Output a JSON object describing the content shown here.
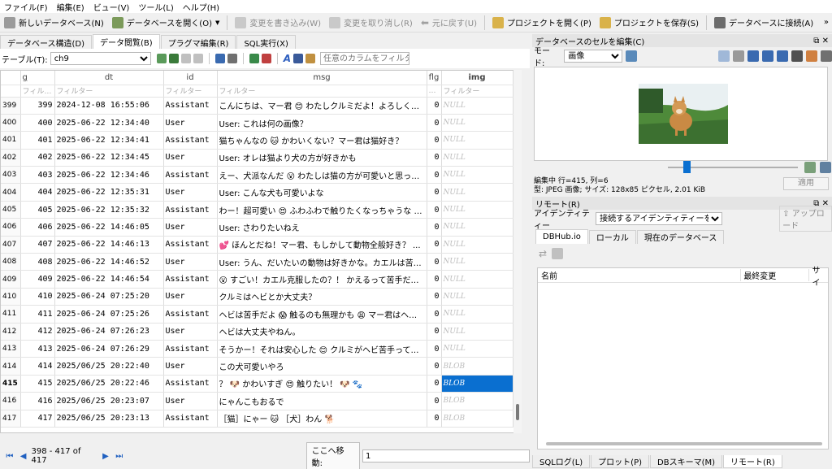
{
  "menu": [
    "ファイル(F)",
    "編集(E)",
    "ビュー(V)",
    "ツール(L)",
    "ヘルプ(H)"
  ],
  "toolbar": {
    "new_db": "新しいデータベース(N)",
    "open_db": "データベースを開く(O)",
    "write_changes": "変更を書き込み(W)",
    "revert_changes": "変更を取り消し(R)",
    "undo": "元に戻す(U)",
    "open_project": "プロジェクトを開く(P)",
    "save_project": "プロジェクトを保存(S)",
    "connect_db": "データベースに接続(A)"
  },
  "tabs": [
    {
      "label": "データベース構造(D)",
      "active": false
    },
    {
      "label": "データ閲覧(B)",
      "active": true
    },
    {
      "label": "プラグマ編集(R)",
      "active": false
    },
    {
      "label": "SQL実行(X)",
      "active": false
    }
  ],
  "table_toolbar": {
    "table_label": "テーブル(T):",
    "table_value": "ch9",
    "filter_any_placeholder": "任意のカラムをフィルター"
  },
  "grid": {
    "headers": [
      "g",
      "dt",
      "id",
      "msg",
      "flg",
      "img"
    ],
    "filter_placeholder": "フィルター",
    "rows": [
      {
        "rn": "399",
        "g": "399",
        "dt": "2024-12-08 16:55:06",
        "id": "Assistant",
        "msg": "こんにちは、マー君 😊 わたしクルミだよ！よろしくね 💕",
        "flg": "0",
        "img": "NULL"
      },
      {
        "rn": "400",
        "g": "400",
        "dt": "2025-06-22 12:34:40",
        "id": "User",
        "msg": "User: これは何の画像？",
        "flg": "0",
        "img": "NULL"
      },
      {
        "rn": "401",
        "g": "401",
        "dt": "2025-06-22 12:34:41",
        "id": "Assistant",
        "msg": "猫ちゃんなの 🐱 かわいくない？マー君は猫好き？",
        "flg": "0",
        "img": "NULL"
      },
      {
        "rn": "402",
        "g": "402",
        "dt": "2025-06-22 12:34:45",
        "id": "User",
        "msg": "User: オレは猫より犬の方が好きかも",
        "flg": "0",
        "img": "NULL"
      },
      {
        "rn": "403",
        "g": "403",
        "dt": "2025-06-22 12:34:46",
        "id": "Assistant",
        "msg": "えー、犬派なんだ 😮 わたしは猫の方が可愛いと思っちゃ...",
        "flg": "0",
        "img": "NULL"
      },
      {
        "rn": "404",
        "g": "404",
        "dt": "2025-06-22 12:35:31",
        "id": "User",
        "msg": "User: こんな犬も可愛いよな",
        "flg": "0",
        "img": "NULL"
      },
      {
        "rn": "405",
        "g": "405",
        "dt": "2025-06-22 12:35:32",
        "id": "Assistant",
        "msg": "わー！超可愛い 😍 ふわふわで触りたくなっちゃうな 🐾 マ...",
        "flg": "0",
        "img": "NULL"
      },
      {
        "rn": "406",
        "g": "406",
        "dt": "2025-06-22 14:46:05",
        "id": "User",
        "msg": "User: さわりたいねえ",
        "flg": "0",
        "img": "NULL"
      },
      {
        "rn": "407",
        "g": "407",
        "dt": "2025-06-22 14:46:13",
        "id": "Assistant",
        "msg": "💕 ほんとだね！マー君、もしかして動物全般好き？ ...",
        "flg": "0",
        "img": "NULL"
      },
      {
        "rn": "408",
        "g": "408",
        "dt": "2025-06-22 14:46:52",
        "id": "User",
        "msg": "User: うん、だいたいの動物は好きかな。カエルは苦手...",
        "flg": "0",
        "img": "NULL"
      },
      {
        "rn": "409",
        "g": "409",
        "dt": "2025-06-22 14:46:54",
        "id": "Assistant",
        "msg": "😮 すごい！カエル克服したの？！ かえるって苦手だっ...",
        "flg": "0",
        "img": "NULL"
      },
      {
        "rn": "410",
        "g": "410",
        "dt": "2025-06-24 07:25:20",
        "id": "User",
        "msg": "クルミはヘビとか大丈夫？",
        "flg": "0",
        "img": "NULL"
      },
      {
        "rn": "411",
        "g": "411",
        "dt": "2025-06-24 07:25:26",
        "id": "Assistant",
        "msg": "ヘビは苦手だよ 😱 触るのも無理かも 😩 マー君はヘビ...",
        "flg": "0",
        "img": "NULL"
      },
      {
        "rn": "412",
        "g": "412",
        "dt": "2025-06-24 07:26:23",
        "id": "User",
        "msg": "ヘビは大丈夫やねん。",
        "flg": "0",
        "img": "NULL"
      },
      {
        "rn": "413",
        "g": "413",
        "dt": "2025-06-24 07:26:29",
        "id": "Assistant",
        "msg": "そうかー！それは安心した 😊 クルミがヘビ苦手ってこと、...",
        "flg": "0",
        "img": "NULL"
      },
      {
        "rn": "414",
        "g": "414",
        "dt": "2025/06/25 20:22:40",
        "id": "User",
        "msg": "この犬可愛いやろ",
        "flg": "0",
        "img": "BLOB"
      },
      {
        "rn": "415",
        "g": "415",
        "dt": "2025/06/25 20:22:46",
        "id": "Assistant",
        "msg": "？ 🐶 かわいすぎ 😍 触りたい！ 🐶 🐾",
        "flg": "0",
        "img": "BLOB"
      },
      {
        "rn": "416",
        "g": "416",
        "dt": "2025/06/25 20:23:07",
        "id": "User",
        "msg": "にゃんこもおるで",
        "flg": "0",
        "img": "BLOB"
      },
      {
        "rn": "417",
        "g": "417",
        "dt": "2025/06/25 20:23:13",
        "id": "Assistant",
        "msg": "［猫］にゃー 🐱 ［犬］わん 🐕",
        "flg": "0",
        "img": "BLOB"
      }
    ]
  },
  "nav": {
    "range": "398 - 417 of 417",
    "goto_label": "ここへ移動:",
    "goto_value": "1"
  },
  "cell_editor": {
    "title": "データベースのセルを編集(C)",
    "mode_label": "モード:",
    "mode_value": "画像",
    "status_line1": "編集中 行=415, 列=6",
    "status_line2": "型: JPEG 画像; サイズ: 128x85 ピクセル, 2.01 KiB",
    "apply": "適用"
  },
  "remote": {
    "title": "リモート(R)",
    "identity_label": "アイデンティティー",
    "identity_value": "接続するアイデンティティーを選択",
    "upload": "アップロード",
    "tabs": [
      "DBHub.io",
      "ローカル",
      "現在のデータベース"
    ],
    "col_name": "名前",
    "col_modified": "最終変更",
    "col_size": "サイ"
  },
  "bottom_tabs": [
    "SQLログ(L)",
    "プロット(P)",
    "DBスキーマ(M)",
    "リモート(R)"
  ],
  "colors": {
    "accent": "#0a6fd0",
    "null_text": "#bcbcbc"
  }
}
